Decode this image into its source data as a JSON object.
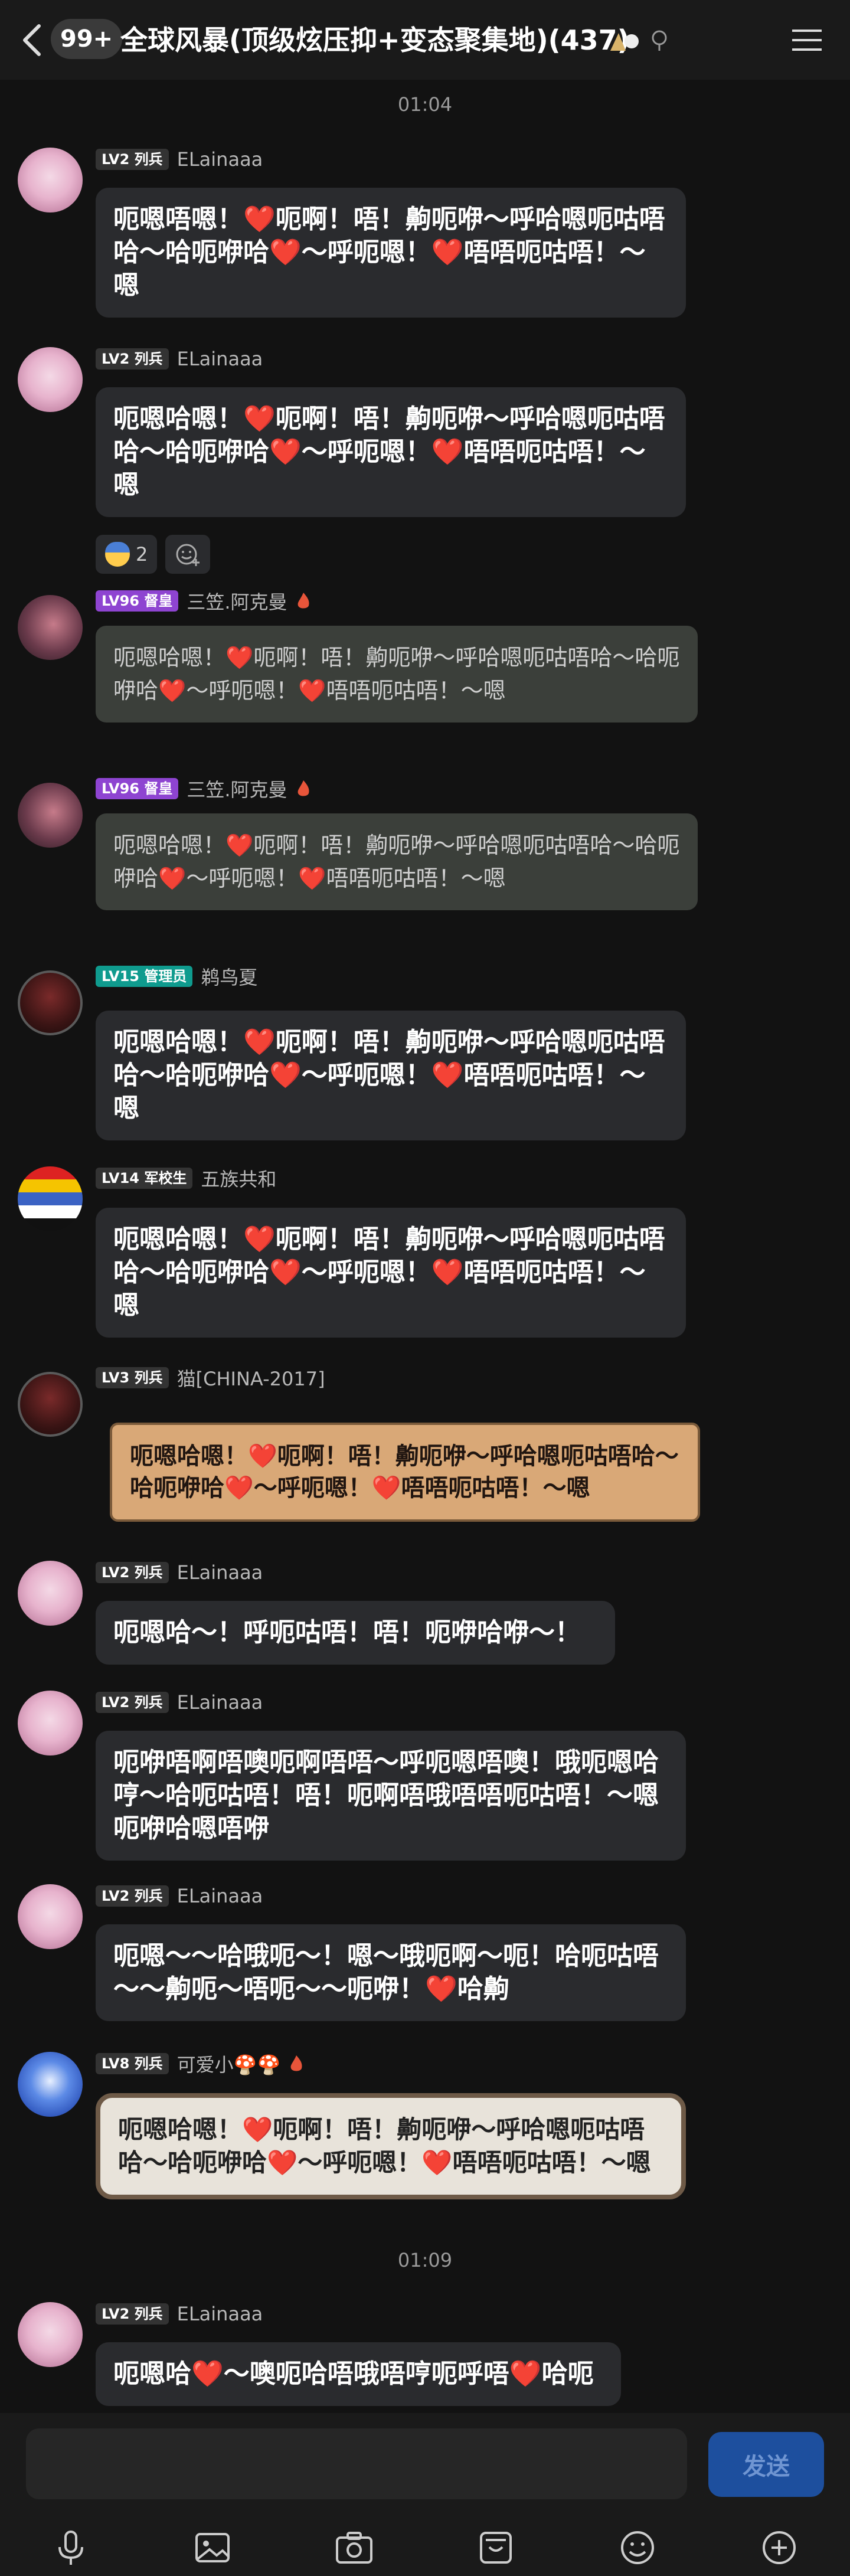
{
  "header": {
    "unread_badge": "99+",
    "title": "全球风暴(顶级炫压抑+变态聚集地)(437)"
  },
  "times": [
    "01:04",
    "01:09"
  ],
  "messages": [
    {
      "level": "LV2 列兵",
      "name": "ELainaaa",
      "text": "呃嗯唔嗯！❤️呃啊！唔！齁呃咿～呼哈嗯呃咕唔哈～哈呃咿哈❤️～呼呃嗯！❤️唔唔呃咕唔！～嗯"
    },
    {
      "level": "LV2 列兵",
      "name": "ELainaaa",
      "text": "呃嗯哈嗯！❤️呃啊！唔！齁呃咿～呼哈嗯呃咕唔哈～哈呃咿哈❤️～呼呃嗯！❤️唔唔呃咕唔！～嗯",
      "reaction_count": "2"
    },
    {
      "level": "LV96 督皇",
      "name": "三笠.阿克曼",
      "text": "呃嗯哈嗯！❤️呃啊！唔！齁呃咿～呼哈嗯呃咕唔哈～哈呃咿哈❤️～呼呃嗯！❤️唔唔呃咕唔！～嗯"
    },
    {
      "level": "LV96 督皇",
      "name": "三笠.阿克曼",
      "text": "呃嗯哈嗯！❤️呃啊！唔！齁呃咿～呼哈嗯呃咕唔哈～哈呃咿哈❤️～呼呃嗯！❤️唔唔呃咕唔！～嗯"
    },
    {
      "level": "LV15 管理员",
      "name": "鹈鸟夏",
      "text": "呃嗯哈嗯！❤️呃啊！唔！齁呃咿～呼哈嗯呃咕唔哈～哈呃咿哈❤️～呼呃嗯！❤️唔唔呃咕唔！～嗯"
    },
    {
      "level": "LV14 军校生",
      "name": "五族共和",
      "text": "呃嗯哈嗯！❤️呃啊！唔！齁呃咿～呼哈嗯呃咕唔哈～哈呃咿哈❤️～呼呃嗯！❤️唔唔呃咕唔！～嗯"
    },
    {
      "level": "LV3 列兵",
      "name": "猫[CHINA-2017]",
      "text": "呃嗯哈嗯！❤️呃啊！唔！齁呃咿～呼哈嗯呃咕唔哈～哈呃咿哈❤️～呼呃嗯！❤️唔唔呃咕唔！～嗯"
    },
    {
      "level": "LV2 列兵",
      "name": "ELainaaa",
      "text": "呃嗯哈～！呼呃咕唔！唔！呃咿哈咿～！"
    },
    {
      "level": "LV2 列兵",
      "name": "ELainaaa",
      "text": "呃咿唔啊唔噢呃啊唔唔～呼呃嗯唔噢！哦呃嗯哈哼～哈呃咕唔！唔！呃啊唔哦唔唔呃咕唔！～嗯呃咿哈嗯唔咿"
    },
    {
      "level": "LV2 列兵",
      "name": "ELainaaa",
      "text": "呃嗯～～哈哦呃～！嗯～哦呃啊～呃！哈呃咕唔～～齁呃～唔呃～～呃咿！❤️哈齁"
    },
    {
      "level": "LV8 列兵",
      "name": "可爱小🍄🍄",
      "text": "呃嗯哈嗯！❤️呃啊！唔！齁呃咿～呼哈嗯呃咕唔哈～哈呃咿哈❤️～呼呃嗯！❤️唔唔呃咕唔！～嗯"
    },
    {
      "level": "LV2 列兵",
      "name": "ELainaaa",
      "text": "呃嗯哈❤️～噢呃哈唔哦唔哼呃呼唔❤️哈呃"
    }
  ],
  "input": {
    "send_label": "发送"
  },
  "icons": [
    "back-icon",
    "menu-icon",
    "mic-icon",
    "image-icon",
    "camera-icon",
    "sticker-icon",
    "emoji-icon",
    "plus-icon"
  ]
}
